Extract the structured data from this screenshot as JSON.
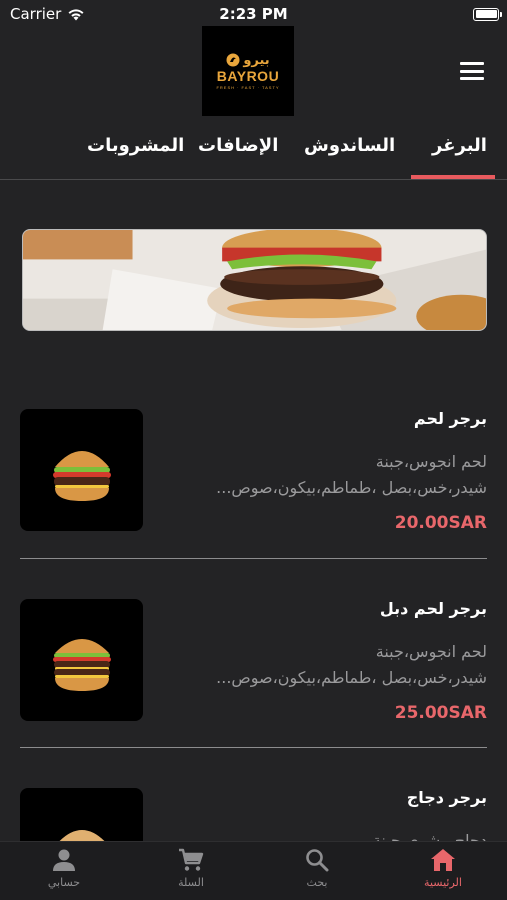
{
  "status_bar": {
    "carrier": "Carrier",
    "time": "2:23 PM"
  },
  "header": {
    "logo": {
      "arabic": "بيرو",
      "brand": "BAYROU",
      "tagline": "FRESH · FAST · TASTY"
    },
    "menu_icon": "hamburger-menu-icon"
  },
  "tabs": [
    {
      "label": "البرغر",
      "active": true
    },
    {
      "label": "الساندوش",
      "active": false
    },
    {
      "label": "الإضافات",
      "active": false
    },
    {
      "label": "المشروبات",
      "active": false
    }
  ],
  "products": [
    {
      "name": "برجر لحم",
      "desc_line1": "لحم انجوس،جبنة",
      "desc_line2": "شيدر،خس،بصل ،طماطم،بيكون،صوص...",
      "price": "20.00SAR"
    },
    {
      "name": "برجر لحم دبل",
      "desc_line1": "لحم انجوس،جبنة",
      "desc_line2": "شيدر،خس،بصل ،طماطم،بيكون،صوص...",
      "price": "25.00SAR"
    },
    {
      "name": "برجر دجاج",
      "desc_line1": "دجاج مشوي،جبنة",
      "desc_line2": "",
      "price": ""
    }
  ],
  "bottom_nav": [
    {
      "label": "الرئيسية",
      "icon": "home-icon",
      "active": true
    },
    {
      "label": "بحث",
      "icon": "search-icon",
      "active": false
    },
    {
      "label": "السلة",
      "icon": "cart-icon",
      "active": false
    },
    {
      "label": "حسابي",
      "icon": "person-icon",
      "active": false
    }
  ],
  "colors": {
    "background": "#232325",
    "accent": "#e85a5e",
    "price": "#e8676b",
    "logo": "#e9a63c"
  }
}
